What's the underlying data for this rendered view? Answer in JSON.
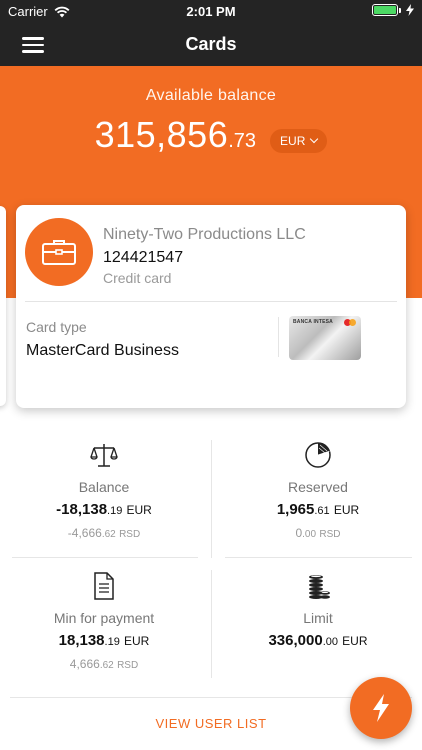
{
  "status_bar": {
    "carrier": "Carrier",
    "time": "2:01 PM",
    "battery_level": 1.0
  },
  "nav": {
    "title": "Cards"
  },
  "header": {
    "available_label": "Available balance",
    "balance_int": "315,856",
    "balance_dec": ".73",
    "currency": "EUR"
  },
  "card": {
    "company": "Ninety-Two Productions LLC",
    "number": "124421547",
    "kind": "Credit card",
    "type_label": "Card type",
    "type_value": "MasterCard Business",
    "thumb_brand": "BANCA INTESA"
  },
  "stats": {
    "balance": {
      "label": "Balance",
      "main_int": "-18,138",
      "main_dec": ".19",
      "main_cur": "EUR",
      "sub_int": "-4,666",
      "sub_dec": ".62",
      "sub_cur": "RSD"
    },
    "reserved": {
      "label": "Reserved",
      "main_int": "1,965",
      "main_dec": ".61",
      "main_cur": "EUR",
      "sub_int": "0",
      "sub_dec": ".00",
      "sub_cur": "RSD"
    },
    "min_payment": {
      "label": "Min for payment",
      "main_int": "18,138",
      "main_dec": ".19",
      "main_cur": "EUR",
      "sub_int": "4,666",
      "sub_dec": ".62",
      "sub_cur": "RSD"
    },
    "limit": {
      "label": "Limit",
      "main_int": "336,000",
      "main_dec": ".00",
      "main_cur": "EUR"
    }
  },
  "footer": {
    "view_user_list": "VIEW USER LIST"
  },
  "colors": {
    "accent": "#f26c23",
    "dark_bar": "#242424",
    "battery": "#4cd964"
  },
  "icons": [
    "menu-icon",
    "wifi-icon",
    "battery-icon",
    "charging-icon",
    "briefcase-icon",
    "scales-icon",
    "pie-chart-icon",
    "document-icon",
    "coins-icon",
    "lightning-icon",
    "chevron-down-icon"
  ]
}
